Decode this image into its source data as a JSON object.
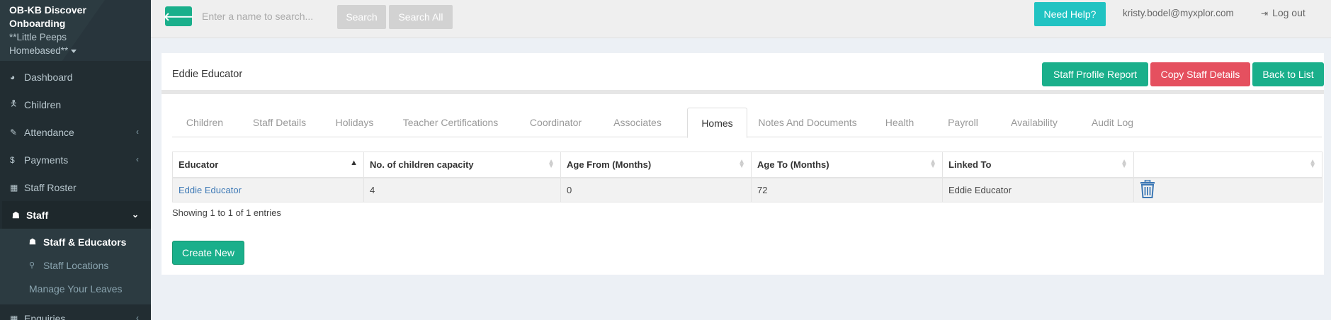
{
  "sidebar": {
    "brand_line1": "OB-KB Discover",
    "brand_line2": "Onboarding",
    "brand_line3": "**Little Peeps",
    "brand_line4": "Homebased**",
    "items": [
      {
        "label": "Dashboard",
        "icon": "dashboard-icon"
      },
      {
        "label": "Children",
        "icon": "child-icon"
      },
      {
        "label": "Attendance",
        "icon": "edit-icon"
      },
      {
        "label": "Payments",
        "icon": "dollar-icon"
      },
      {
        "label": "Staff Roster",
        "icon": "calendar-icon"
      },
      {
        "label": "Staff",
        "icon": "sitemap-icon"
      },
      {
        "label": "Enquiries",
        "icon": "grid-icon"
      }
    ],
    "staff_sub": [
      {
        "label": "Staff & Educators"
      },
      {
        "label": "Staff Locations"
      },
      {
        "label": "Manage Your Leaves"
      }
    ]
  },
  "topbar": {
    "search_placeholder": "Enter a name to search...",
    "search_label": "Search",
    "search_all_label": "Search All",
    "help_label": "Need Help?",
    "user_email": "kristy.bodel@myxplor.com",
    "logout_label": "Log out"
  },
  "page": {
    "title": "Eddie Educator",
    "buttons": {
      "profile_report": "Staff Profile Report",
      "copy_details": "Copy Staff Details",
      "back_to_list": "Back to List"
    },
    "tabs": [
      "Children",
      "Staff Details",
      "Holidays",
      "Teacher Certifications",
      "Coordinator",
      "Associates",
      "Homes",
      "Notes And Documents",
      "Health",
      "Payroll",
      "Availability",
      "Audit Log"
    ],
    "active_tab": "Homes"
  },
  "table": {
    "headers": [
      "Educator",
      "No. of children capacity",
      "Age From (Months)",
      "Age To (Months)",
      "Linked To",
      ""
    ],
    "rows": [
      [
        "Eddie Educator",
        "4",
        "0",
        "72",
        "Eddie Educator"
      ]
    ],
    "info": "Showing 1 to 1 of 1 entries",
    "create_label": "Create New"
  },
  "colors": {
    "sidebar_bg": "#222d32",
    "primary_green": "#1aaf8b",
    "danger_red": "#e5505f",
    "help_cyan": "#21c3c2",
    "link_blue": "#3c78b5"
  }
}
